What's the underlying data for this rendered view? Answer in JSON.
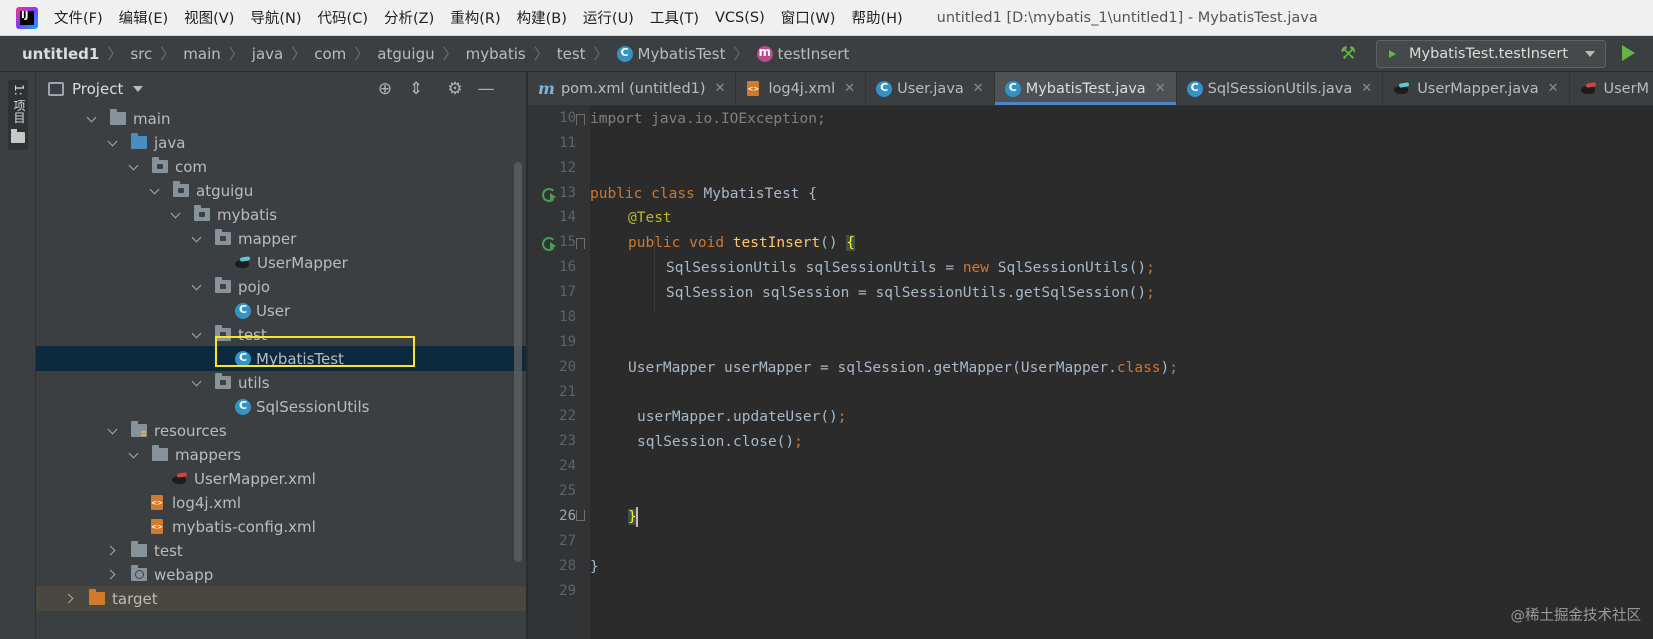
{
  "menubar": {
    "logo_text": "IJ",
    "items": [
      "文件(F)",
      "编辑(E)",
      "视图(V)",
      "导航(N)",
      "代码(C)",
      "分析(Z)",
      "重构(R)",
      "构建(B)",
      "运行(U)",
      "工具(T)",
      "VCS(S)",
      "窗口(W)",
      "帮助(H)"
    ],
    "window_title": "untitled1 [D:\\mybatis_1\\untitled1] - MybatisTest.java"
  },
  "navbar": {
    "crumbs": [
      "untitled1",
      "src",
      "main",
      "java",
      "com",
      "atguigu",
      "mybatis",
      "test",
      "MybatisTest",
      "testInsert"
    ],
    "run_config": "MybatisTest.testInsert"
  },
  "stripe": {
    "project_label": "1: 项目"
  },
  "project": {
    "title": "Project",
    "tree": [
      {
        "label": "main",
        "icon": "folder",
        "chev": "down"
      },
      {
        "label": "java",
        "icon": "folder-blue",
        "chev": "down"
      },
      {
        "label": "com",
        "icon": "package",
        "chev": "down"
      },
      {
        "label": "atguigu",
        "icon": "package",
        "chev": "down"
      },
      {
        "label": "mybatis",
        "icon": "package",
        "chev": "down"
      },
      {
        "label": "mapper",
        "icon": "package",
        "chev": "down"
      },
      {
        "label": "UserMapper",
        "icon": "mapper-interface",
        "chev": "none"
      },
      {
        "label": "pojo",
        "icon": "package",
        "chev": "down"
      },
      {
        "label": "User",
        "icon": "class",
        "chev": "none"
      },
      {
        "label": "test",
        "icon": "package",
        "chev": "down"
      },
      {
        "label": "MybatisTest",
        "icon": "class",
        "chev": "none",
        "selected": true
      },
      {
        "label": "utils",
        "icon": "package",
        "chev": "down"
      },
      {
        "label": "SqlSessionUtils",
        "icon": "class",
        "chev": "none"
      },
      {
        "label": "resources",
        "icon": "folder-resources",
        "chev": "down"
      },
      {
        "label": "mappers",
        "icon": "folder",
        "chev": "down"
      },
      {
        "label": "UserMapper.xml",
        "icon": "mapper-xml",
        "chev": "none"
      },
      {
        "label": "log4j.xml",
        "icon": "xml",
        "chev": "none"
      },
      {
        "label": "mybatis-config.xml",
        "icon": "xml",
        "chev": "none"
      },
      {
        "label": "test",
        "icon": "folder",
        "chev": "right"
      },
      {
        "label": "webapp",
        "icon": "folder-web",
        "chev": "right"
      },
      {
        "label": "target",
        "icon": "folder-orange",
        "chev": "right"
      }
    ]
  },
  "editor": {
    "tabs": [
      {
        "label": "pom.xml (untitled1)",
        "icon": "maven"
      },
      {
        "label": "log4j.xml",
        "icon": "xml"
      },
      {
        "label": "User.java",
        "icon": "class"
      },
      {
        "label": "MybatisTest.java",
        "icon": "class",
        "active": true
      },
      {
        "label": "SqlSessionUtils.java",
        "icon": "class"
      },
      {
        "label": "UserMapper.java",
        "icon": "mapper-interface"
      },
      {
        "label": "UserM",
        "icon": "mapper-xml"
      }
    ],
    "line_numbers": [
      "10",
      "11",
      "12",
      "13",
      "14",
      "15",
      "16",
      "17",
      "18",
      "19",
      "20",
      "21",
      "22",
      "23",
      "24",
      "25",
      "26",
      "27",
      "28",
      "29"
    ],
    "current_line": "26",
    "code": {
      "l10": "import java.io.IOException;",
      "l13_kw1": "public",
      "l13_kw2": "class",
      "l13_rest": " MybatisTest {",
      "l14_ann": "@Test",
      "l15_kw1": "public",
      "l15_kw2": "void",
      "l15_fn": "testInsert",
      "l15_rest": "() ",
      "l15_brace": "{",
      "l16_a": "SqlSessionUtils sqlSessionUtils = ",
      "l16_kw": "new",
      "l16_b": " SqlSessionUtils()",
      "l17_a": "SqlSession sqlSession = sqlSessionUtils.getSqlSession()",
      "l20_a": "UserMapper userMapper = sqlSession.getMapper(UserMapper.",
      "l20_kw": "class",
      "l20_b": ")",
      "l22_a": "userMapper.updateUser()",
      "l23_a": "sqlSession.close()",
      "semicolon": ";",
      "l26_brace": "}",
      "l28_brace": "}"
    }
  },
  "watermark": "@稀土掘金技术社区"
}
